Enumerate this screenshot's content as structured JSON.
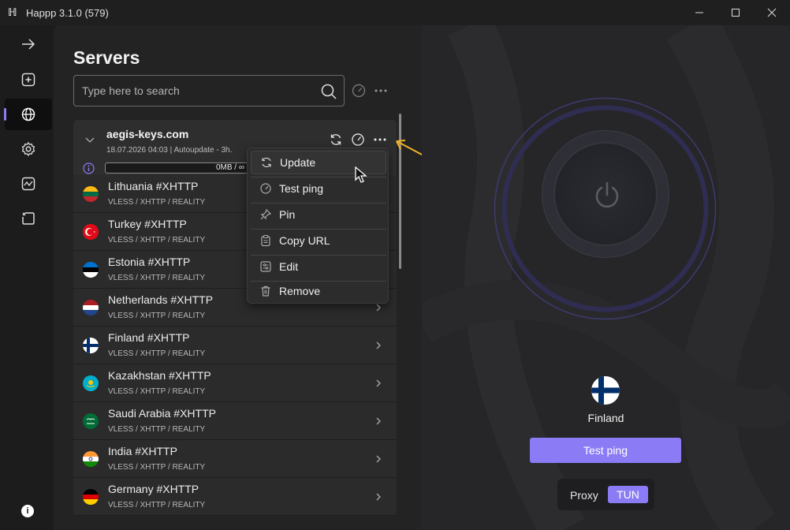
{
  "window": {
    "title": "Happp 3.1.0 (579)"
  },
  "servers": {
    "title": "Servers",
    "search": {
      "placeholder": "Type here to search",
      "value": ""
    },
    "group": {
      "name": "aegis-keys.com",
      "meta": "18.07.2026 04:03 | Autoupdate - 3h.",
      "traffic": "0MB / ∞"
    },
    "items": [
      {
        "name": "Lithuania #XHTTP",
        "protocol": "VLESS / XHTTP / REALITY",
        "flag": "lithuania-flag"
      },
      {
        "name": "Turkey #XHTTP",
        "protocol": "VLESS / XHTTP / REALITY",
        "flag": "turkey-flag"
      },
      {
        "name": "Estonia #XHTTP",
        "protocol": "VLESS / XHTTP / REALITY",
        "flag": "estonia-flag"
      },
      {
        "name": "Netherlands #XHTTP",
        "protocol": "VLESS / XHTTP / REALITY",
        "flag": "netherlands-flag"
      },
      {
        "name": "Finland #XHTTP",
        "protocol": "VLESS / XHTTP / REALITY",
        "flag": "finland-flag"
      },
      {
        "name": "Kazakhstan #XHTTP",
        "protocol": "VLESS / XHTTP / REALITY",
        "flag": "kazakhstan-flag"
      },
      {
        "name": "Saudi Arabia #XHTTP",
        "protocol": "VLESS / XHTTP / REALITY",
        "flag": "saudi-arabia-flag"
      },
      {
        "name": "India #XHTTP",
        "protocol": "VLESS / XHTTP / REALITY",
        "flag": "india-flag"
      },
      {
        "name": "Germany #XHTTP",
        "protocol": "VLESS / XHTTP / REALITY",
        "flag": "germany-flag"
      }
    ]
  },
  "menu": {
    "update": "Update",
    "test_ping": "Test ping",
    "pin": "Pin",
    "copy_url": "Copy URL",
    "edit": "Edit",
    "remove": "Remove"
  },
  "connection": {
    "selected": "Finland",
    "test_ping": "Test ping",
    "mode_proxy": "Proxy",
    "mode_tun": "TUN"
  },
  "colors": {
    "accent": "#8b7cf6",
    "annotation": "#f0b429"
  }
}
